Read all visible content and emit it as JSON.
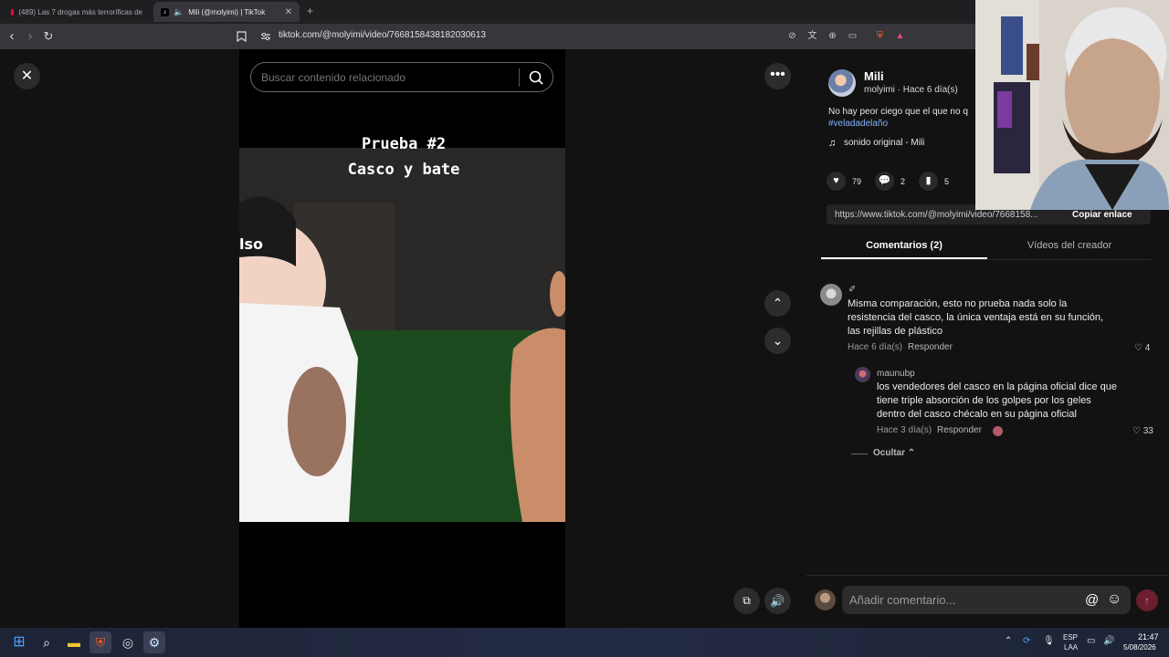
{
  "browser": {
    "tabs": [
      {
        "title": "(489) Las 7 drogas más terroríficas de",
        "active": false
      },
      {
        "title": "Mili (@molyimi) | TikTok",
        "active": true
      }
    ],
    "new_tab": "+",
    "url": "tiktok.com/@molyimi/video/7668158438182030613"
  },
  "search": {
    "placeholder": "Buscar contenido relacionado"
  },
  "video": {
    "caption_line1": "Prueba #2",
    "caption_line2": "Casco y bate",
    "helmet_text": "lso"
  },
  "author": {
    "name": "Mili",
    "handle_time": "molyimi · Hace 6 día(s)",
    "description": "No hay peor ciego que el que no q",
    "hashtag": "#veladadelaño",
    "music": "sonido original - Mili"
  },
  "stats": {
    "likes": "79",
    "comments": "2",
    "saves": "5"
  },
  "link": {
    "url": "https://www.tiktok.com/@molyimi/video/7668158...",
    "copy_label": "Copiar enlace"
  },
  "tabs": {
    "comments": "Comentarios (2)",
    "creator_videos": "Vídeos del creador"
  },
  "comments": [
    {
      "user": "✐",
      "text": "Misma comparación, esto no prueba nada solo la resistencia del casco, la única ventaja está en su función, las rejillas de plástico",
      "time": "Hace 6 día(s)",
      "reply_label": "Responder",
      "likes": "4"
    }
  ],
  "reply": {
    "user": "maunubp",
    "text": "los vendedores del casco en la página oficial dice que tiene triple absorción de los golpes por los geles dentro del casco chécalo en su página oficial",
    "time": "Hace 3 día(s)",
    "reply_label": "Responder",
    "likes": "33"
  },
  "hide_replies": "Ocultar",
  "comment_input": {
    "placeholder": "Añadir comentario..."
  },
  "taskbar": {
    "lang1": "ESP",
    "lang2": "LAA",
    "time": "21:47",
    "date": "5/08/2026"
  },
  "colors": {
    "accent": "#fe2c55",
    "hashtag": "#7fb3ff",
    "panel": "#121212"
  }
}
